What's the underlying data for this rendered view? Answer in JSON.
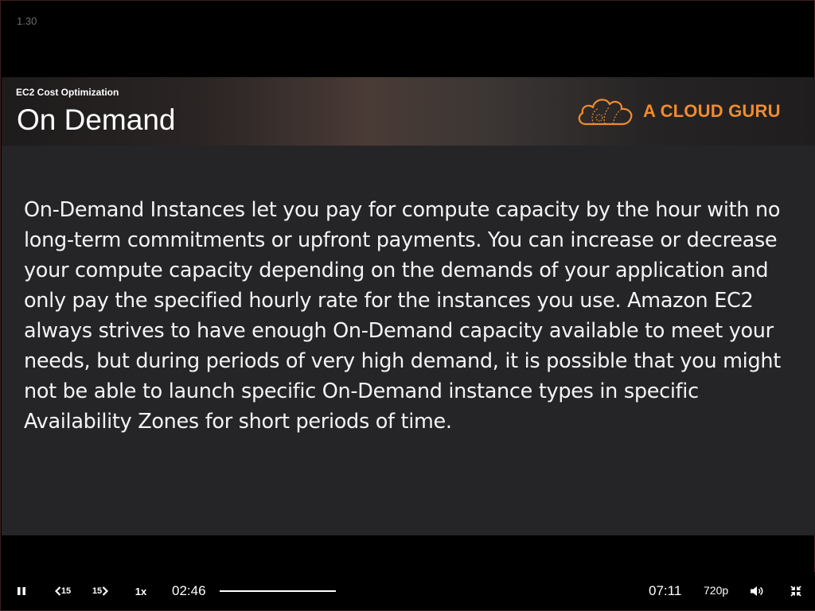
{
  "top_label": "1.30",
  "slide": {
    "section": "EC2 Cost Optimization",
    "title": "On Demand",
    "logo_text": "A CLOUD GURU",
    "body": "On-Demand Instances let you pay for compute capacity by the hour with no long-term commitments or upfront payments. You can increase or decrease your compute capacity depending on the demands of your application and only pay the specified hourly rate for the instances you use. Amazon EC2 always strives to have enough On-Demand capacity available to meet your needs, but during periods of very high demand, it is possible that you might not be able to launch specific On-Demand instance types in specific Availability Zones for short periods of time."
  },
  "controls": {
    "skip_back_label": "15",
    "skip_forward_label": "15",
    "speed_label": "1x",
    "current_time": "02:46",
    "duration": "07:11",
    "quality_label": "720p",
    "icons": {
      "pause": "pause-icon",
      "skip_back": "skip-back-icon",
      "skip_forward": "skip-forward-icon",
      "volume": "volume-icon",
      "exit_fullscreen": "exit-fullscreen-icon"
    }
  },
  "colors": {
    "brand_orange": "#f08c2c",
    "slide_background": "#252427",
    "player_background": "#000000"
  }
}
